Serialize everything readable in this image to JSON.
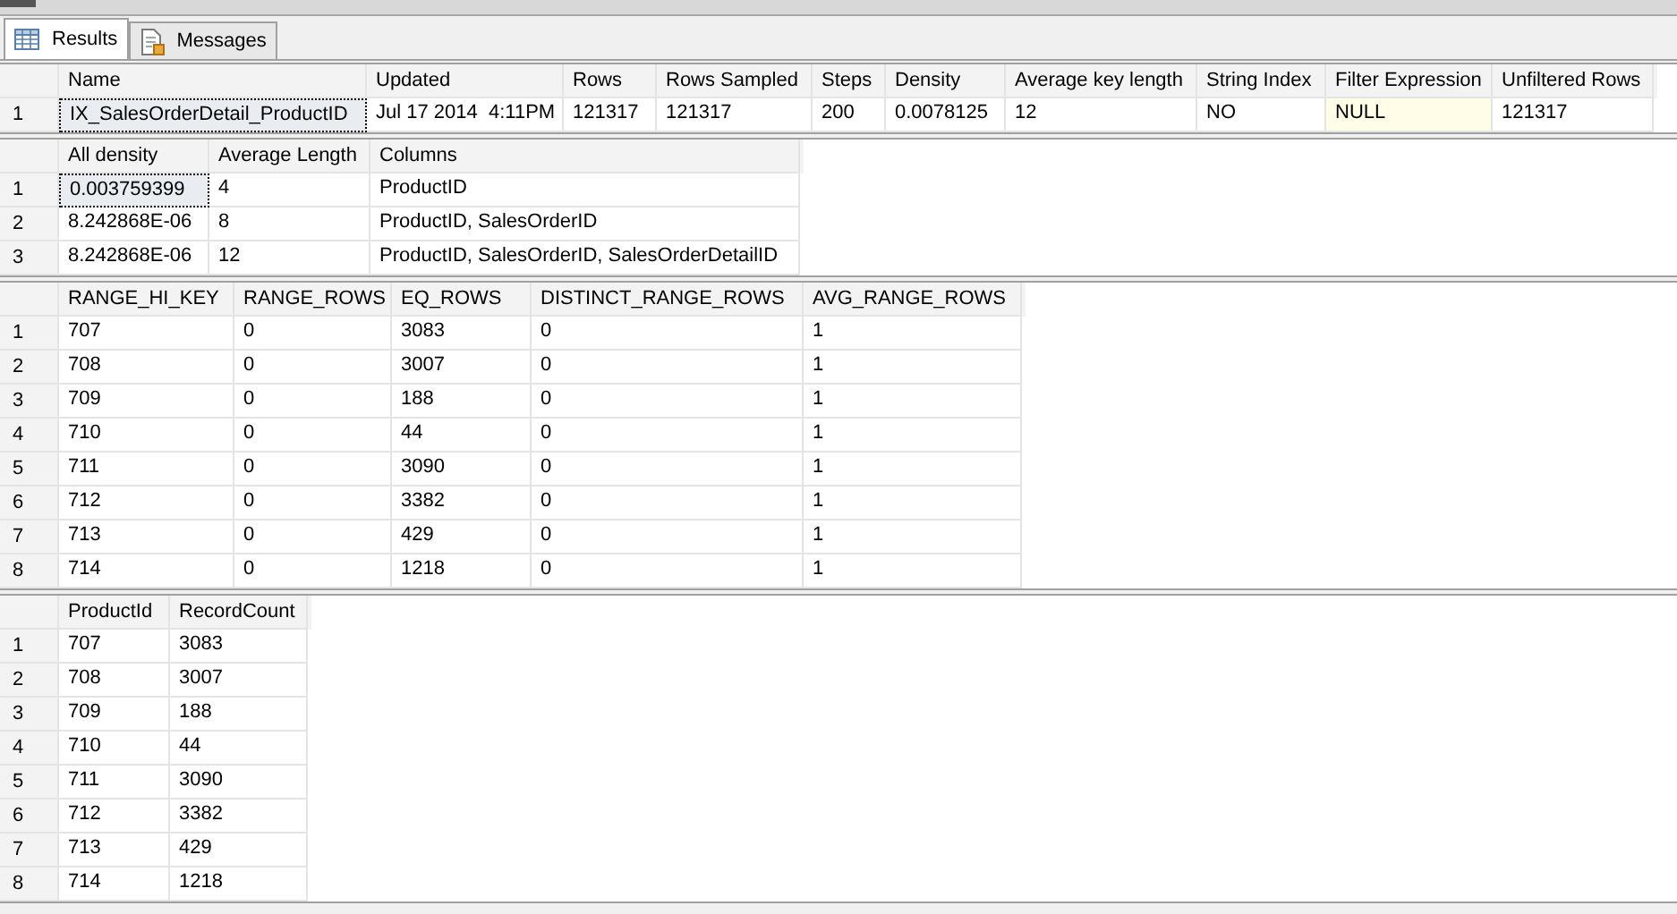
{
  "tabs": [
    {
      "label": "Results",
      "selected": true,
      "kind": "grid"
    },
    {
      "label": "Messages",
      "selected": false,
      "kind": "messages"
    }
  ],
  "grids": [
    {
      "columns": [
        "Name",
        "Updated",
        "Rows",
        "Rows Sampled",
        "Steps",
        "Density",
        "Average key length",
        "String Index",
        "Filter Expression",
        "Unfiltered Rows"
      ],
      "rows": [
        {
          "number": "1",
          "cells": [
            {
              "text": "IX_SalesOrderDetail_ProductID",
              "selected": true,
              "kind": "value"
            },
            {
              "text": "Jul 17 2014  4:11PM",
              "selected": false,
              "kind": "value"
            },
            {
              "text": "121317",
              "selected": false,
              "kind": "value"
            },
            {
              "text": "121317",
              "selected": false,
              "kind": "value"
            },
            {
              "text": "200",
              "selected": false,
              "kind": "value"
            },
            {
              "text": "0.0078125",
              "selected": false,
              "kind": "value"
            },
            {
              "text": "12",
              "selected": false,
              "kind": "value"
            },
            {
              "text": "NO",
              "selected": false,
              "kind": "value"
            },
            {
              "text": "NULL",
              "selected": false,
              "kind": "null"
            },
            {
              "text": "121317",
              "selected": false,
              "kind": "value"
            }
          ]
        }
      ]
    },
    {
      "columns": [
        "All density",
        "Average Length",
        "Columns"
      ],
      "rows": [
        {
          "number": "1",
          "cells": [
            {
              "text": "0.003759399",
              "selected": true,
              "kind": "value"
            },
            {
              "text": "4",
              "selected": false,
              "kind": "value"
            },
            {
              "text": "ProductID",
              "selected": false,
              "kind": "value"
            }
          ]
        },
        {
          "number": "2",
          "cells": [
            {
              "text": "8.242868E-06",
              "selected": false,
              "kind": "value"
            },
            {
              "text": "8",
              "selected": false,
              "kind": "value"
            },
            {
              "text": "ProductID, SalesOrderID",
              "selected": false,
              "kind": "value"
            }
          ]
        },
        {
          "number": "3",
          "cells": [
            {
              "text": "8.242868E-06",
              "selected": false,
              "kind": "value"
            },
            {
              "text": "12",
              "selected": false,
              "kind": "value"
            },
            {
              "text": "ProductID, SalesOrderID, SalesOrderDetailID",
              "selected": false,
              "kind": "value"
            }
          ]
        }
      ]
    },
    {
      "columns": [
        "RANGE_HI_KEY",
        "RANGE_ROWS",
        "EQ_ROWS",
        "DISTINCT_RANGE_ROWS",
        "AVG_RANGE_ROWS"
      ],
      "rows": [
        {
          "number": "1",
          "cells": [
            "707",
            "0",
            "3083",
            "0",
            "1"
          ]
        },
        {
          "number": "2",
          "cells": [
            "708",
            "0",
            "3007",
            "0",
            "1"
          ]
        },
        {
          "number": "3",
          "cells": [
            "709",
            "0",
            "188",
            "0",
            "1"
          ]
        },
        {
          "number": "4",
          "cells": [
            "710",
            "0",
            "44",
            "0",
            "1"
          ]
        },
        {
          "number": "5",
          "cells": [
            "711",
            "0",
            "3090",
            "0",
            "1"
          ]
        },
        {
          "number": "6",
          "cells": [
            "712",
            "0",
            "3382",
            "0",
            "1"
          ]
        },
        {
          "number": "7",
          "cells": [
            "713",
            "0",
            "429",
            "0",
            "1"
          ]
        },
        {
          "number": "8",
          "cells": [
            "714",
            "0",
            "1218",
            "0",
            "1"
          ]
        }
      ]
    },
    {
      "columns": [
        "ProductId",
        "RecordCount"
      ],
      "rows": [
        {
          "number": "1",
          "cells": [
            "707",
            "3083"
          ]
        },
        {
          "number": "2",
          "cells": [
            "708",
            "3007"
          ]
        },
        {
          "number": "3",
          "cells": [
            "709",
            "188"
          ]
        },
        {
          "number": "4",
          "cells": [
            "710",
            "44"
          ]
        },
        {
          "number": "5",
          "cells": [
            "711",
            "3090"
          ]
        },
        {
          "number": "6",
          "cells": [
            "712",
            "3382"
          ]
        },
        {
          "number": "7",
          "cells": [
            "713",
            "429"
          ]
        },
        {
          "number": "8",
          "cells": [
            "714",
            "1218"
          ]
        }
      ]
    }
  ]
}
